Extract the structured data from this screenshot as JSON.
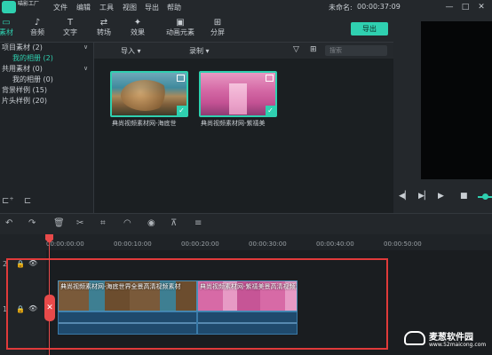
{
  "app": {
    "logo_text": "喵影工厂",
    "menu": [
      "文件",
      "编辑",
      "工具",
      "视图",
      "导出",
      "帮助"
    ],
    "title": "未命名:",
    "timecode": "00:00:37:09",
    "window_buttons": [
      "—",
      "□",
      "✕"
    ]
  },
  "toolbar": {
    "tools": [
      {
        "label": "素材",
        "icon": "folder-icon"
      },
      {
        "label": "音频",
        "icon": "music-note-icon"
      },
      {
        "label": "文字",
        "icon": "text-icon"
      },
      {
        "label": "转场",
        "icon": "transition-icon"
      },
      {
        "label": "效果",
        "icon": "effects-icon"
      },
      {
        "label": "动画元素",
        "icon": "image-icon"
      },
      {
        "label": "分屏",
        "icon": "split-screen-icon"
      }
    ],
    "export_label": "导出"
  },
  "library": {
    "items": [
      {
        "label": "项目素材 (2)",
        "level": 0,
        "expanded": true
      },
      {
        "label": "我的相册 (2)",
        "level": 1,
        "selected": true
      },
      {
        "label": "共用素材 (0)",
        "level": 0,
        "expanded": true
      },
      {
        "label": "我的相册 (0)",
        "level": 1
      },
      {
        "label": "背景样例 (15)",
        "level": 0
      },
      {
        "label": "片头样例 (20)",
        "level": 0
      }
    ]
  },
  "media": {
    "import_label": "导入",
    "record_label": "录制",
    "search_placeholder": "搜索",
    "thumbnails": [
      {
        "caption": "典尚视频素材网-海底世"
      },
      {
        "caption": "典尚视频素材网-紫禧美"
      }
    ]
  },
  "timeline": {
    "ticks": [
      "00:00:00:00",
      "00:00:10:00",
      "00:00:20:00",
      "00:00:30:00",
      "00:00:40:00",
      "00:00:50:00"
    ],
    "tracks": [
      {
        "number": "2"
      },
      {
        "number": "1"
      }
    ],
    "clips": [
      {
        "title": "典尚视频素材网-海底世界全景高清视频素材"
      },
      {
        "title": "典尚视频素材网-紫禧美景高清视频素材"
      }
    ]
  },
  "watermark": {
    "text": "麦葱软件园",
    "url": "www.52maicong.com"
  },
  "colors": {
    "accent": "#2fd0b0",
    "playhead": "#e84a4a",
    "selection": "#e03a3a"
  }
}
